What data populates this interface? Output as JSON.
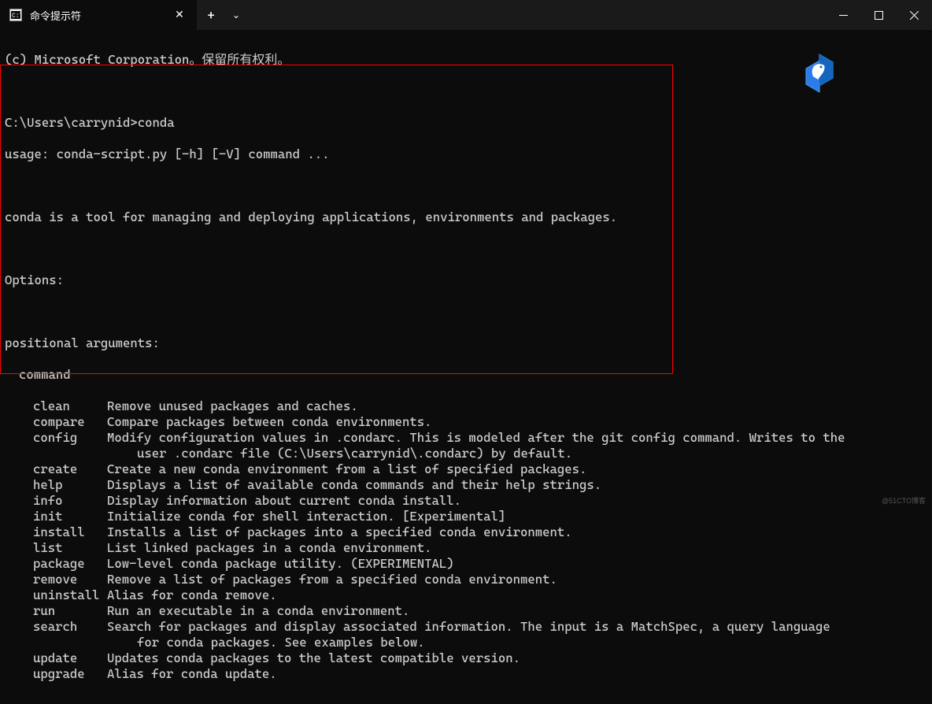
{
  "titlebar": {
    "tab_title": "命令提示符",
    "close": "✕",
    "new_tab": "+",
    "dropdown": "⌄",
    "minimize": "—",
    "maximize": "☐"
  },
  "terminal": {
    "copyright": "(c) Microsoft Corporation。保留所有权利。",
    "prompt": "C:\\Users\\carrynid>",
    "command": "conda",
    "usage": "usage: conda-script.py [-h] [-V] command ...",
    "description": "conda is a tool for managing and deploying applications, environments and packages.",
    "options_header": "Options:",
    "positional_header": "positional arguments:",
    "cmd_label": "command",
    "commands": [
      {
        "name": "clean",
        "desc": "Remove unused packages and caches."
      },
      {
        "name": "compare",
        "desc": "Compare packages between conda environments."
      },
      {
        "name": "config",
        "desc": "Modify configuration values in .condarc. This is modeled after the git config command. Writes to the",
        "cont": "user .condarc file (C:\\Users\\carrynid\\.condarc) by default."
      },
      {
        "name": "create",
        "desc": "Create a new conda environment from a list of specified packages."
      },
      {
        "name": "help",
        "desc": "Displays a list of available conda commands and their help strings."
      },
      {
        "name": "info",
        "desc": "Display information about current conda install."
      },
      {
        "name": "init",
        "desc": "Initialize conda for shell interaction. [Experimental]"
      },
      {
        "name": "install",
        "desc": "Installs a list of packages into a specified conda environment."
      },
      {
        "name": "list",
        "desc": "List linked packages in a conda environment."
      },
      {
        "name": "package",
        "desc": "Low-level conda package utility. (EXPERIMENTAL)"
      },
      {
        "name": "remove",
        "desc": "Remove a list of packages from a specified conda environment."
      },
      {
        "name": "uninstall",
        "desc": "Alias for conda remove."
      },
      {
        "name": "run",
        "desc": "Run an executable in a conda environment."
      },
      {
        "name": "search",
        "desc": "Search for packages and display associated information. The input is a MatchSpec, a query language",
        "cont": "for conda packages. See examples below."
      },
      {
        "name": "update",
        "desc": "Updates conda packages to the latest compatible version."
      },
      {
        "name": "upgrade",
        "desc": "Alias for conda update."
      }
    ]
  },
  "watermark": "@51CTO博客"
}
